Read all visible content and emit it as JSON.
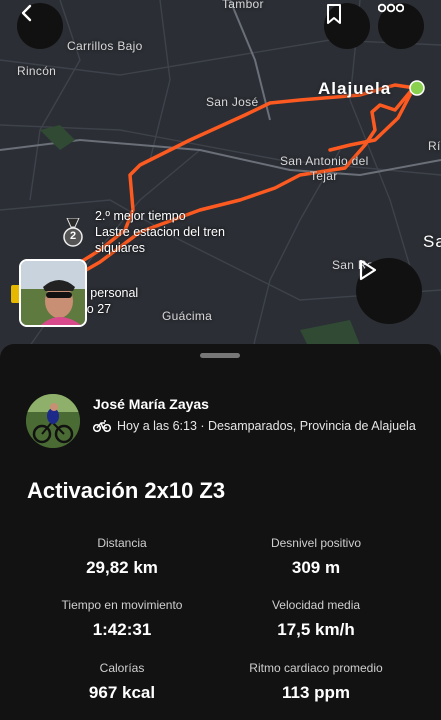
{
  "map": {
    "places": [
      "Tambor",
      "Carrillos Bajo",
      "Rincón",
      "San José",
      "Alajuela",
      "Rí",
      "San Antonio del",
      "Tejar",
      "Sa",
      "San Ra",
      "Guácima"
    ],
    "segment_label": [
      "2.º mejor tiempo",
      "Lastre estacion del tren",
      "siquiares"
    ],
    "pr_label": [
      "l personal",
      "lo 27"
    ],
    "medal_number": "2"
  },
  "activity": {
    "athlete": "José María Zayas",
    "meta": "Hoy a las 6:13 · Desamparados, Provincia de Alajuela",
    "title": "Activación 2x10 Z3",
    "stats": [
      {
        "label": "Distancia",
        "value": "29,82 km"
      },
      {
        "label": "Desnivel positivo",
        "value": "309 m"
      },
      {
        "label": "Tiempo en movimiento",
        "value": "1:42:31"
      },
      {
        "label": "Velocidad media",
        "value": "17,5 km/h"
      },
      {
        "label": "Calorías",
        "value": "967 kcal"
      },
      {
        "label": "Ritmo cardiaco promedio",
        "value": "113 ppm"
      }
    ]
  },
  "colors": {
    "route": "#fc5a20",
    "start_dot": "#8ad14f",
    "sheet_bg": "#121212",
    "map_bg": "#2b2e34"
  },
  "icons": [
    "back-arrow-icon",
    "bookmark-icon",
    "more-icon",
    "play-icon",
    "bike-icon",
    "medal-icon"
  ]
}
